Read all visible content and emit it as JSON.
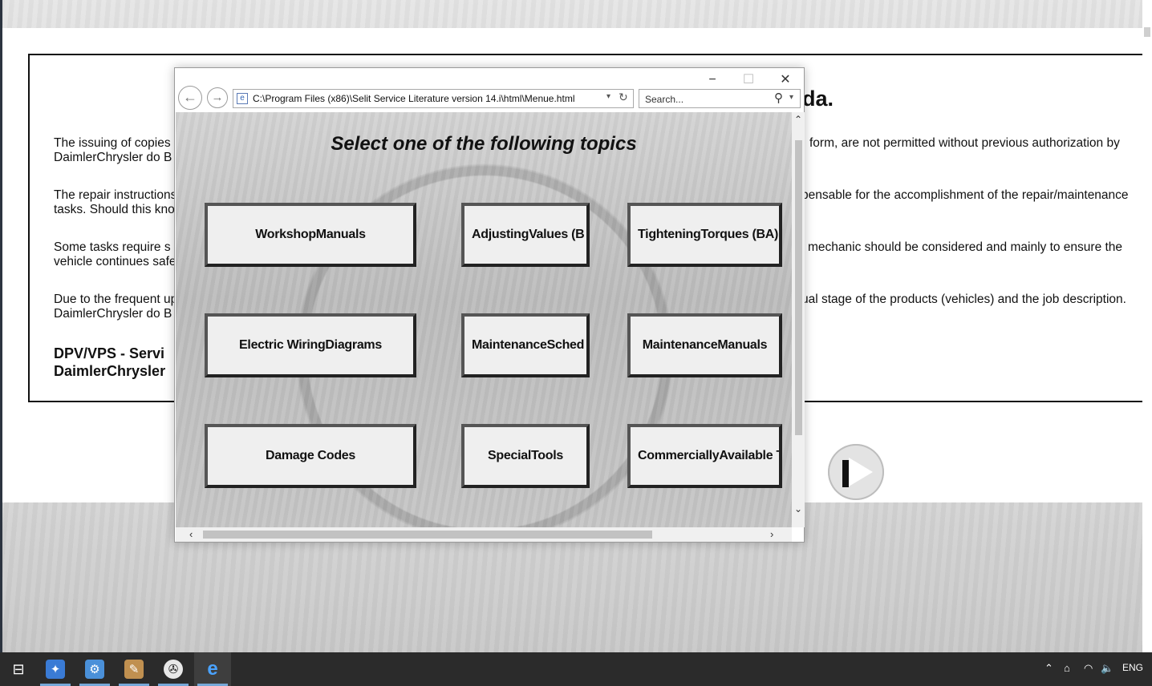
{
  "background_page": {
    "notice_title": "da.",
    "paragraphs": [
      {
        "left": "The issuing of copies",
        "right": "form, are not permitted without previous authorization by",
        "line2": "DaimlerChrysler do B"
      },
      {
        "left": "The repair instructions",
        "right": "pensable for the accomplishment of the repair/maintenance",
        "line2": "tasks. Should this kno"
      },
      {
        "left": "Some tasks require s",
        "right": "mechanic should be considered and mainly to ensure the",
        "line2": "vehicle continues safe"
      },
      {
        "left": "Due to the frequent up",
        "right": "ual stage of the products (vehicles) and the job description.",
        "line2": "DaimlerChrysler do B"
      }
    ],
    "footer_line1": "DPV/VPS - Servi",
    "footer_line2": "DaimlerChrysler"
  },
  "browser": {
    "minimize": "−",
    "maximize": "☐",
    "close": "✕",
    "back": "←",
    "forward": "→",
    "address": "C:\\Program Files (x86)\\Selit Service Literature version 14.i\\html\\Menue.html",
    "address_dropdown": "▾",
    "refresh": "↻",
    "search_placeholder": "Search...",
    "search_icon": "⚲",
    "search_dropdown": "▾"
  },
  "menu": {
    "heading": "Select one of the following topics",
    "topics": [
      "WorkshopManuals",
      "AdjustingValues (B",
      "TighteningTorques (BA)",
      "Electric WiringDiagrams",
      "MaintenanceSched",
      "MaintenanceManuals",
      "Damage Codes",
      "SpecialTools",
      "CommerciallyAvailable T"
    ]
  },
  "scrollbars": {
    "up": "⌃",
    "down": "⌄",
    "left": "‹",
    "right": "›"
  },
  "taskbar": {
    "task_view": "⊟",
    "apps": [
      {
        "name": "app-1",
        "glyph": "✦",
        "color": "#3a7bd5"
      },
      {
        "name": "app-settings",
        "glyph": "⚙",
        "color": "#4a90d9"
      },
      {
        "name": "app-paint",
        "glyph": "✎",
        "color": "#c09050"
      },
      {
        "name": "app-mercedes",
        "glyph": "✇",
        "color": "#e8e8e8"
      },
      {
        "name": "app-internet-explorer",
        "glyph": "e",
        "color": "#1e88e5"
      }
    ],
    "tray": {
      "chevron": "⌃",
      "network": "⌂",
      "wifi": "◠",
      "volume": "🔈",
      "language": "ENG"
    }
  }
}
